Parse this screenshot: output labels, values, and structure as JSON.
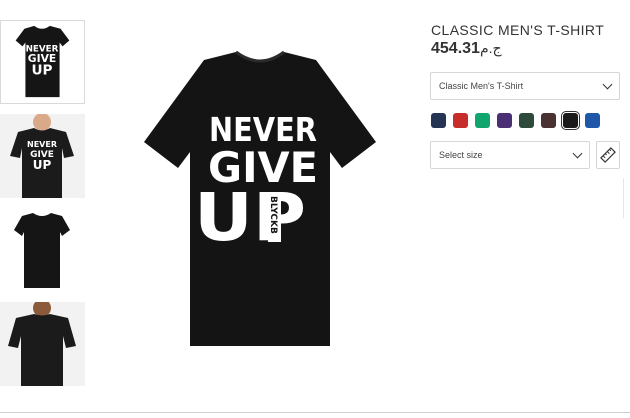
{
  "product": {
    "title": "CLASSIC MEN'S T-SHIRT",
    "price": "454.31",
    "currency": "ج.م"
  },
  "style_select": {
    "value": "Classic Men's T-Shirt"
  },
  "size_select": {
    "value": "Select size"
  },
  "shirt_print": {
    "line1": "NEVER",
    "line2": "GIVE",
    "line3": "UP",
    "vertical": "BLYCKB"
  },
  "colors": [
    {
      "name": "navy",
      "hex": "#263453"
    },
    {
      "name": "red",
      "hex": "#c62d2b"
    },
    {
      "name": "green",
      "hex": "#11a66e"
    },
    {
      "name": "purple",
      "hex": "#4a2f74"
    },
    {
      "name": "forest",
      "hex": "#2e4a3a"
    },
    {
      "name": "maroon",
      "hex": "#4a3233"
    },
    {
      "name": "black",
      "hex": "#1b1b1b",
      "selected": true
    },
    {
      "name": "royal",
      "hex": "#1e56a8"
    }
  ],
  "icons": {
    "dropdown": "chevron-down-icon",
    "size_guide": "ruler-icon"
  },
  "thumbnails": [
    "front-print",
    "model-front",
    "plain-front",
    "model-back"
  ]
}
